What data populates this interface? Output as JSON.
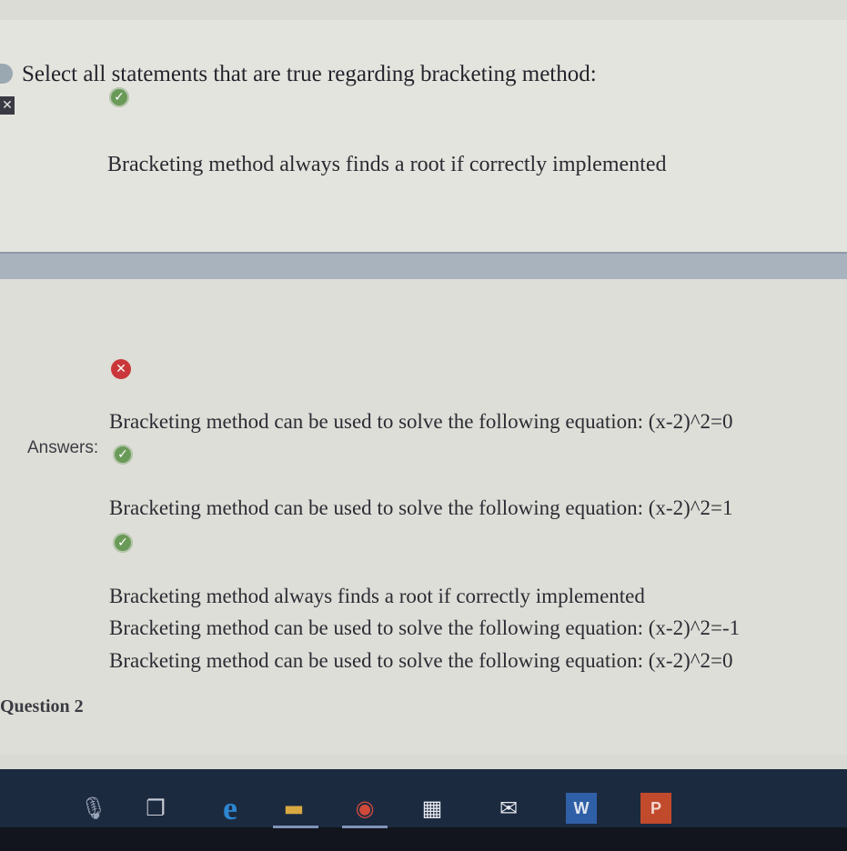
{
  "question": {
    "prompt": "Select all statements that are true regarding bracketing method:",
    "selected_answer": "Bracketing method always finds a root if correctly implemented"
  },
  "answers_section": {
    "label": "Answers:",
    "items": [
      "Bracketing method can be used to solve the following equation: (x-2)^2=0",
      "Bracketing method can be used to solve the following equation: (x-2)^2=1",
      "Bracketing method always finds a root if correctly implemented",
      "Bracketing method can be used to solve the following equation: (x-2)^2=-1",
      "Bracketing method can be used to solve the following equation: (x-2)^2=0"
    ]
  },
  "next_question": {
    "label": "Question 2"
  },
  "icons": {
    "check": "check-icon",
    "cross": "cross-icon"
  },
  "colors": {
    "correct": "#6a9a58",
    "incorrect": "#c9373b",
    "taskbar": "#1c2a40"
  },
  "taskbar": {
    "items": [
      {
        "name": "cortana-mic-icon",
        "glyph": "🎙"
      },
      {
        "name": "task-view-icon",
        "glyph": "❐"
      },
      {
        "name": "edge-icon",
        "glyph": "e"
      },
      {
        "name": "file-explorer-icon",
        "glyph": "▬"
      },
      {
        "name": "chrome-icon",
        "glyph": "◉"
      },
      {
        "name": "store-icon",
        "glyph": "▦"
      },
      {
        "name": "mail-icon",
        "glyph": "✉"
      },
      {
        "name": "word-icon",
        "glyph": "W"
      },
      {
        "name": "powerpoint-icon",
        "glyph": "P"
      }
    ]
  }
}
